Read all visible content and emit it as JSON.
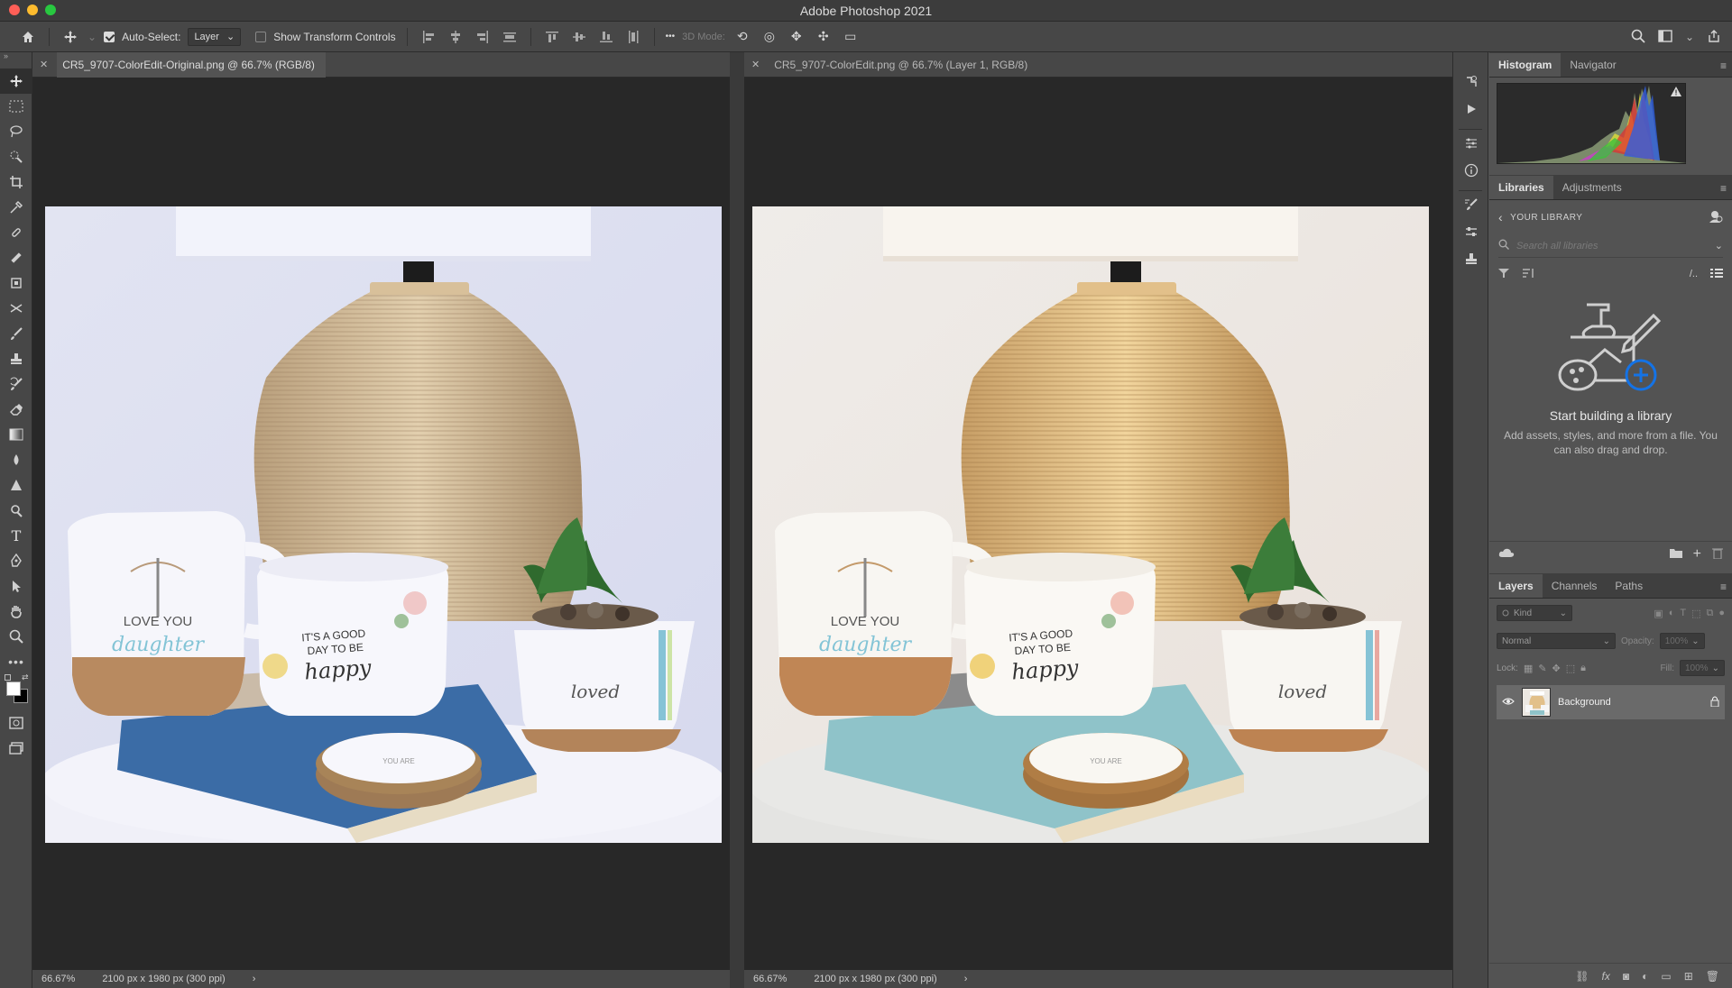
{
  "window": {
    "title": "Adobe Photoshop 2021"
  },
  "options_bar": {
    "auto_select_label": "Auto-Select:",
    "auto_select_value": "Layer",
    "show_transform_label": "Show Transform Controls",
    "more_label": "•••",
    "mode_3d_label": "3D Mode:"
  },
  "documents": [
    {
      "tab_title": "CR5_9707-ColorEdit-Original.png @ 66.7% (RGB/8)",
      "zoom": "66.67%",
      "size_info": "2100 px x 1980 px (300 ppi)"
    },
    {
      "tab_title": "CR5_9707-ColorEdit.png @ 66.7% (Layer 1, RGB/8)",
      "zoom": "66.67%",
      "size_info": "2100 px x 1980 px (300 ppi)"
    }
  ],
  "panels": {
    "histogram_tab": "Histogram",
    "navigator_tab": "Navigator",
    "libraries_tab": "Libraries",
    "adjustments_tab": "Adjustments",
    "library_header": "YOUR LIBRARY",
    "library_search_placeholder": "Search all libraries",
    "library_empty_title": "Start building a library",
    "library_empty_text": "Add assets, styles, and more from a file. You can also drag and drop.",
    "layers_tab": "Layers",
    "channels_tab": "Channels",
    "paths_tab": "Paths",
    "kind_label": "Kind",
    "blend_mode": "Normal",
    "opacity_label": "Opacity:",
    "opacity_value": "100%",
    "lock_label": "Lock:",
    "fill_label": "Fill:",
    "fill_value": "100%",
    "layer_name": "Background"
  },
  "colors": {
    "app_bg": "#535353",
    "panel_dark": "#474747",
    "canvas_bg": "#282828",
    "highlight_blue": "#1473e6"
  },
  "photo_text": {
    "mug": "LOVE YOU",
    "mug_script": "daughter",
    "candle_line1": "IT'S A GOOD",
    "candle_line2": "DAY TO BE",
    "candle_script": "happy",
    "pot": "loved",
    "coaster": "YOU ARE"
  }
}
